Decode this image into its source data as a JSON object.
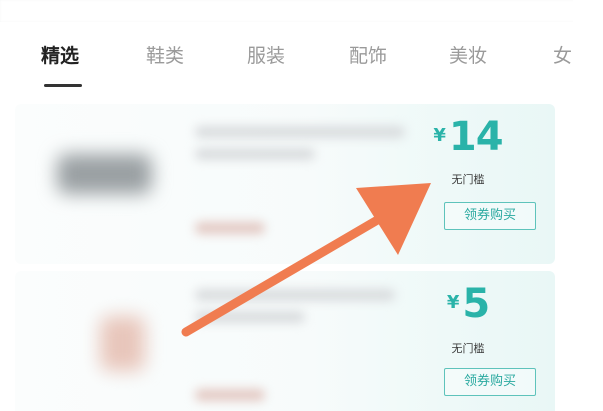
{
  "tabs": [
    {
      "label": "精选",
      "active": true
    },
    {
      "label": "鞋类",
      "active": false
    },
    {
      "label": "服装",
      "active": false
    },
    {
      "label": "配饰",
      "active": false
    },
    {
      "label": "美妆",
      "active": false
    },
    {
      "label": "女",
      "active": false
    }
  ],
  "coupons": [
    {
      "currency_symbol": "¥",
      "amount": "14",
      "condition": "无门槛",
      "button_label": "领券购买"
    },
    {
      "currency_symbol": "¥",
      "amount": "5",
      "condition": "无门槛",
      "button_label": "领券购买"
    }
  ],
  "colors": {
    "accent": "#2ab3a9",
    "arrow": "#f07c50",
    "active_tab": "#222222",
    "inactive_tab": "#9a9a9a"
  },
  "icons": {
    "annotation": "pointer-arrow-icon"
  }
}
